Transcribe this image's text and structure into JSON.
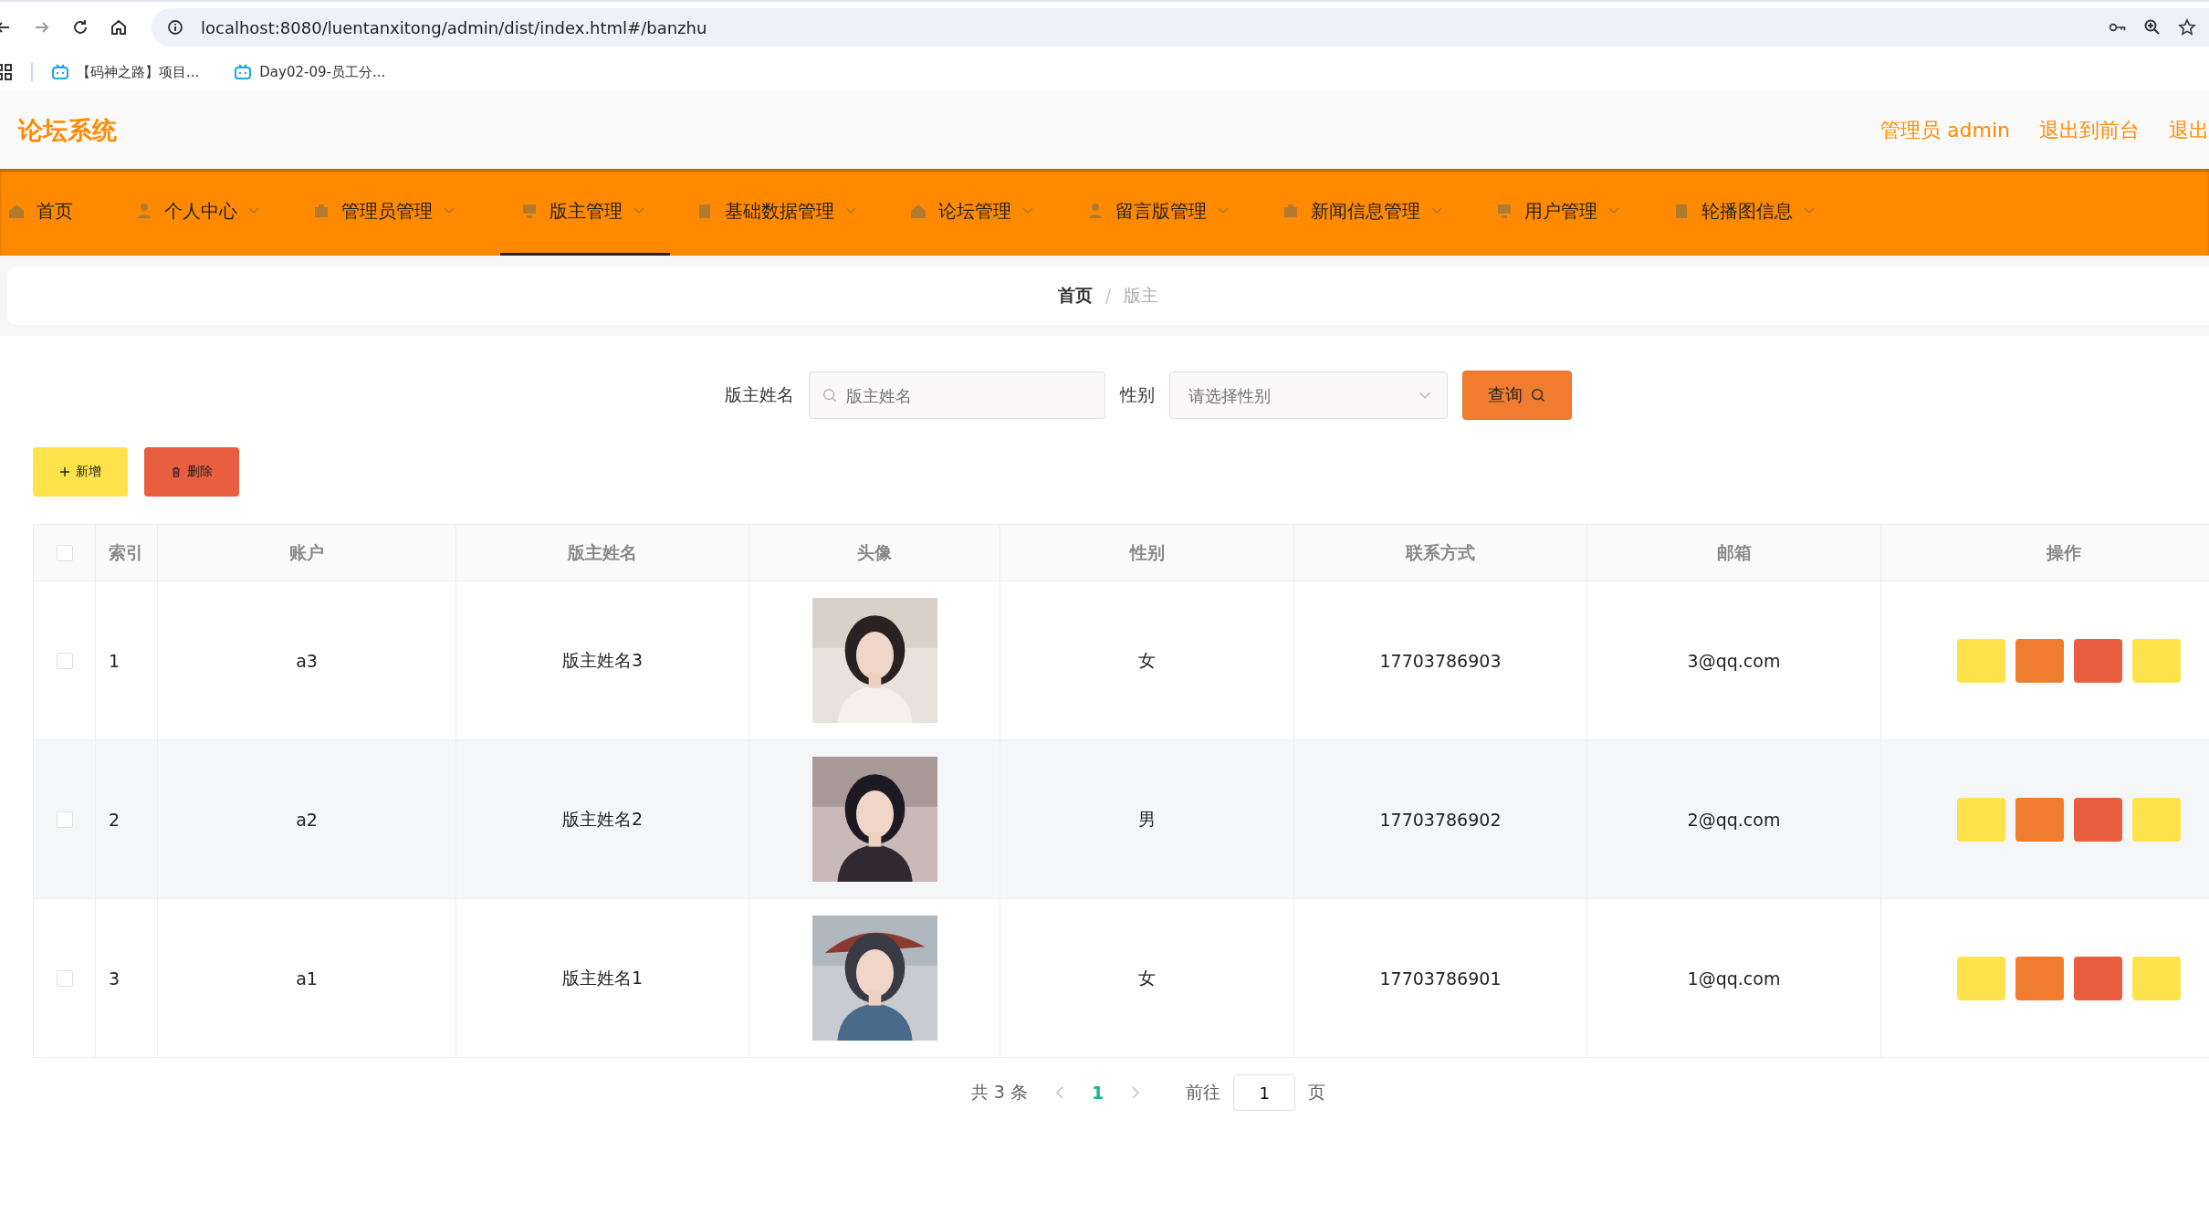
{
  "browser": {
    "url": "localhost:8080/luentanxitong/admin/dist/index.html#/banzhu",
    "bookmarks": [
      "【码神之路】项目...",
      "Day02-09-员工分..."
    ]
  },
  "header": {
    "title": "论坛系统",
    "links": [
      "管理员 admin",
      "退出到前台",
      "退出"
    ]
  },
  "nav": {
    "items": [
      {
        "label": "首页",
        "selected": false,
        "has_submenu": false
      },
      {
        "label": "个人中心",
        "selected": false,
        "has_submenu": true
      },
      {
        "label": "管理员管理",
        "selected": false,
        "has_submenu": true
      },
      {
        "label": "版主管理",
        "selected": true,
        "has_submenu": true
      },
      {
        "label": "基础数据管理",
        "selected": false,
        "has_submenu": true
      },
      {
        "label": "论坛管理",
        "selected": false,
        "has_submenu": true
      },
      {
        "label": "留言版管理",
        "selected": false,
        "has_submenu": true
      },
      {
        "label": "新闻信息管理",
        "selected": false,
        "has_submenu": true
      },
      {
        "label": "用户管理",
        "selected": false,
        "has_submenu": true
      },
      {
        "label": "轮播图信息",
        "selected": false,
        "has_submenu": true
      }
    ]
  },
  "breadcrumb": [
    "首页",
    "版主"
  ],
  "breadcrumb_separator": "/",
  "search": {
    "fields": [
      {
        "kind": "text",
        "label": "版主姓名",
        "placeholder": "版主姓名"
      },
      {
        "kind": "select",
        "label": "性别",
        "placeholder": "请选择性别"
      }
    ],
    "button": "查询"
  },
  "toolbar": [
    {
      "kind": "add",
      "label": "新增"
    },
    {
      "kind": "delete",
      "label": "删除"
    }
  ],
  "table": {
    "columns": [
      "索引",
      "账户",
      "版主姓名",
      "头像",
      "性别",
      "联系方式",
      "邮箱",
      "操作"
    ],
    "header_checked": false,
    "row_actions": [
      {
        "color": "#fee34c"
      },
      {
        "color": "#f07c30"
      },
      {
        "color": "#e95e3e"
      },
      {
        "color": "#fee34c"
      }
    ],
    "rows": [
      {
        "checked": false,
        "index": "1",
        "account": "a3",
        "name": "版主姓名3",
        "gender": "女",
        "phone": "17703786903",
        "email": "3@qq.com"
      },
      {
        "checked": false,
        "index": "2",
        "account": "a2",
        "name": "版主姓名2",
        "gender": "男",
        "phone": "17703786902",
        "email": "2@qq.com"
      },
      {
        "checked": false,
        "index": "3",
        "account": "a1",
        "name": "版主姓名1",
        "gender": "女",
        "phone": "17703786901",
        "email": "1@qq.com"
      }
    ]
  },
  "pagination": {
    "total": "共 3 条",
    "pages": [
      {
        "label": "1",
        "selected": true
      }
    ],
    "goto_label": "前往",
    "goto_value": "1",
    "unit": "页"
  }
}
